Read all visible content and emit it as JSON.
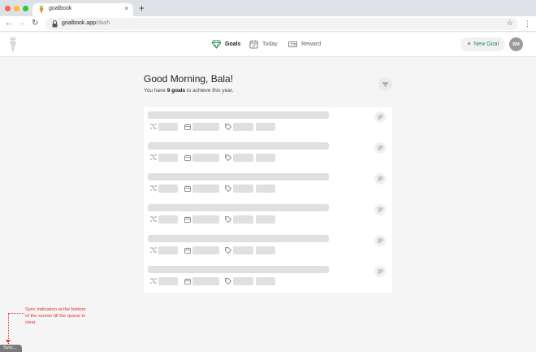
{
  "browser": {
    "tab_title": "goalbook",
    "tab_close": "×",
    "new_tab": "+",
    "url_host": "goalbook.app",
    "url_path": "/dash",
    "icons": [
      "back-icon",
      "forward-icon",
      "reload-icon",
      "lock-icon",
      "star-icon",
      "menu-icon"
    ]
  },
  "nav": {
    "items": [
      {
        "label": "Goals",
        "icon": "diamond-icon",
        "active": true
      },
      {
        "label": "Today",
        "icon": "calendar-check-icon",
        "active": false
      },
      {
        "label": "Reward",
        "icon": "ticket-icon",
        "active": false
      }
    ],
    "new_goal_label": "New Goal",
    "avatar_initials": "BM"
  },
  "main": {
    "greeting": "Good Morning, Bala!",
    "subtitle_prefix": "You have ",
    "subtitle_count": "9 goals",
    "subtitle_suffix": " to achieve this year."
  },
  "goals": {
    "placeholder_count": 6,
    "state": "loading-skeleton"
  },
  "annotation": {
    "text": "Sync indication at the bottom of the screen till the queue is clear.",
    "sync_label": "Sync..."
  },
  "colors": {
    "accent": "#2e8b57",
    "annotation": "#dd3333",
    "skeleton": "#e0e0e0"
  }
}
